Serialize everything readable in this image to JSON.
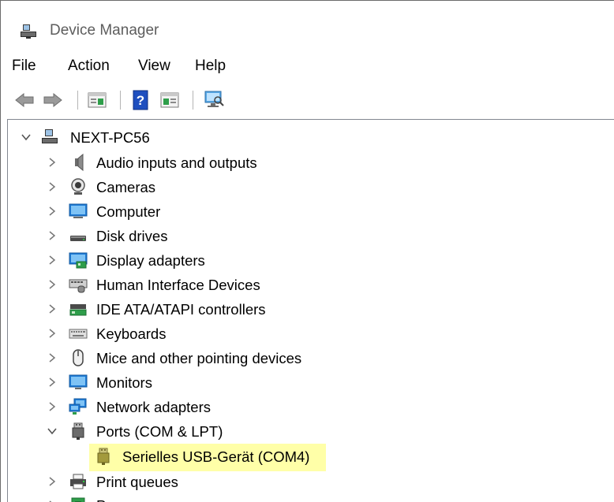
{
  "window": {
    "title": "Device Manager"
  },
  "menu": {
    "items": [
      "File",
      "Action",
      "View",
      "Help"
    ]
  },
  "toolbar": {
    "buttons": [
      "back-icon",
      "forward-icon",
      "properties-icon",
      "help-icon",
      "action-pane-icon",
      "scan-hardware-icon"
    ]
  },
  "tree": {
    "root": "NEXT-PC56",
    "categories": [
      {
        "label": "Audio inputs and outputs",
        "icon": "speaker-icon"
      },
      {
        "label": "Cameras",
        "icon": "camera-icon"
      },
      {
        "label": "Computer",
        "icon": "computer-icon"
      },
      {
        "label": "Disk drives",
        "icon": "disk-drive-icon"
      },
      {
        "label": "Display adapters",
        "icon": "display-adapter-icon"
      },
      {
        "label": "Human Interface Devices",
        "icon": "hid-icon"
      },
      {
        "label": "IDE ATA/ATAPI controllers",
        "icon": "ide-controller-icon"
      },
      {
        "label": "Keyboards",
        "icon": "keyboard-icon"
      },
      {
        "label": "Mice and other pointing devices",
        "icon": "mouse-icon"
      },
      {
        "label": "Monitors",
        "icon": "monitor-icon"
      },
      {
        "label": "Network adapters",
        "icon": "network-adapter-icon"
      },
      {
        "label": "Ports (COM & LPT)",
        "icon": "port-icon",
        "expanded": true
      },
      {
        "label": "Serielles USB-Gerät (COM4)",
        "icon": "usb-serial-icon",
        "child": true,
        "highlighted": true
      },
      {
        "label": "Print queues",
        "icon": "printer-icon"
      },
      {
        "label": "P",
        "icon": "processor-icon"
      }
    ]
  },
  "colors": {
    "highlight": "#ffff99",
    "title_text": "#5d5d5d",
    "accent_blue": "#1e7bd6"
  }
}
